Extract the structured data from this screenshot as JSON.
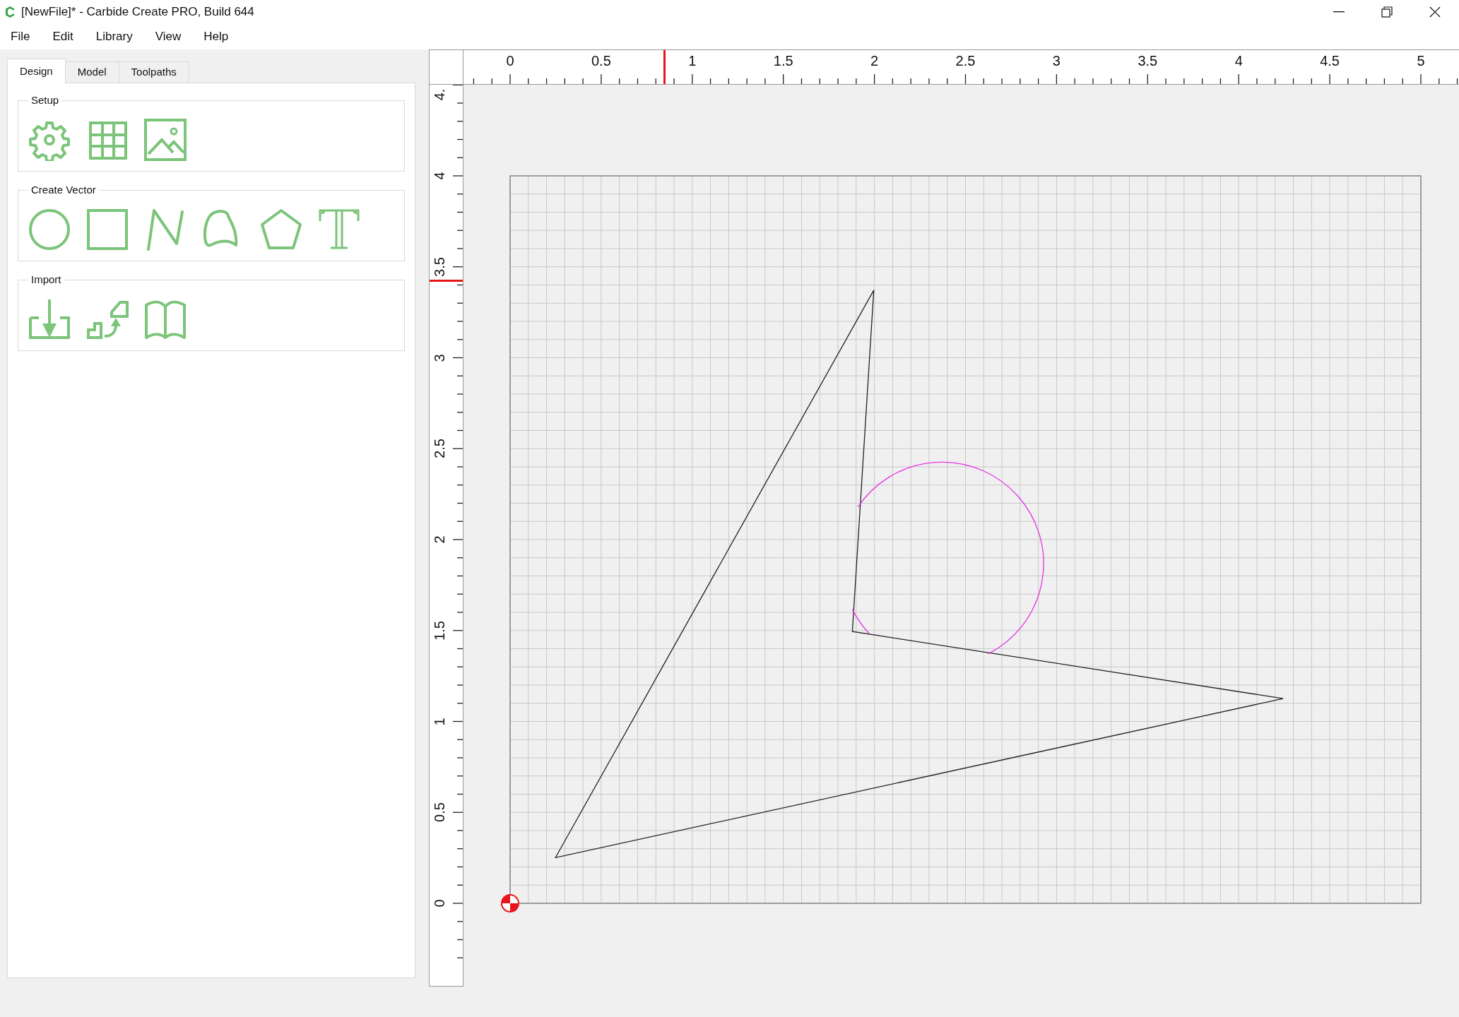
{
  "window": {
    "title": "[NewFile]* - Carbide Create PRO, Build 644"
  },
  "menu": [
    "File",
    "Edit",
    "Library",
    "View",
    "Help"
  ],
  "tabs": [
    {
      "label": "Design",
      "selected": true
    },
    {
      "label": "Model",
      "selected": false
    },
    {
      "label": "Toolpaths",
      "selected": false
    }
  ],
  "groups": [
    {
      "title": "Setup"
    },
    {
      "title": "Create Vector"
    },
    {
      "title": "Import"
    }
  ],
  "top_ruler": {
    "labels": [
      "0",
      "0.5",
      "1",
      "1.5",
      "2",
      "2.5",
      "3",
      "3.5",
      "4",
      "4.5",
      "5"
    ]
  },
  "left_ruler": {
    "labels": [
      "0",
      "0.5",
      "1",
      "1.5",
      "2",
      "2.5",
      "3",
      "3.5",
      "4",
      "4."
    ]
  }
}
